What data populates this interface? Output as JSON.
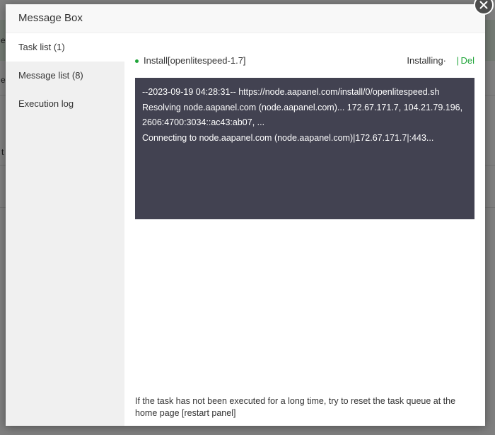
{
  "background": {
    "fragments": [
      "e",
      "e",
      "t"
    ]
  },
  "modal": {
    "title": "Message Box",
    "close_icon": "close-icon",
    "tabs": [
      {
        "label": "Task list (1)",
        "active": true
      },
      {
        "label": "Message list (8)",
        "active": false
      },
      {
        "label": "Execution log",
        "active": false
      }
    ]
  },
  "task": {
    "name": "Install[openlitespeed-1.7]",
    "status": "Installing·",
    "separator": "|",
    "delete_label": "Del"
  },
  "console": {
    "lines": [
      "--2023-09-19 04:28:31-- https://node.aapanel.com/install/0/openlitespeed.sh",
      "Resolving node.aapanel.com (node.aapanel.com)... 172.67.171.7, 104.21.79.196, 2606:4700:3034::ac43:ab07, ...",
      "Connecting to node.aapanel.com (node.aapanel.com)|172.67.171.7|:443..."
    ]
  },
  "hint": "If the task has not been executed for a long time, try to reset the task queue at the home page [restart panel]",
  "colors": {
    "accent": "#20a53a",
    "console_bg": "#424251",
    "sidebar_bg": "#f0f0f0"
  }
}
